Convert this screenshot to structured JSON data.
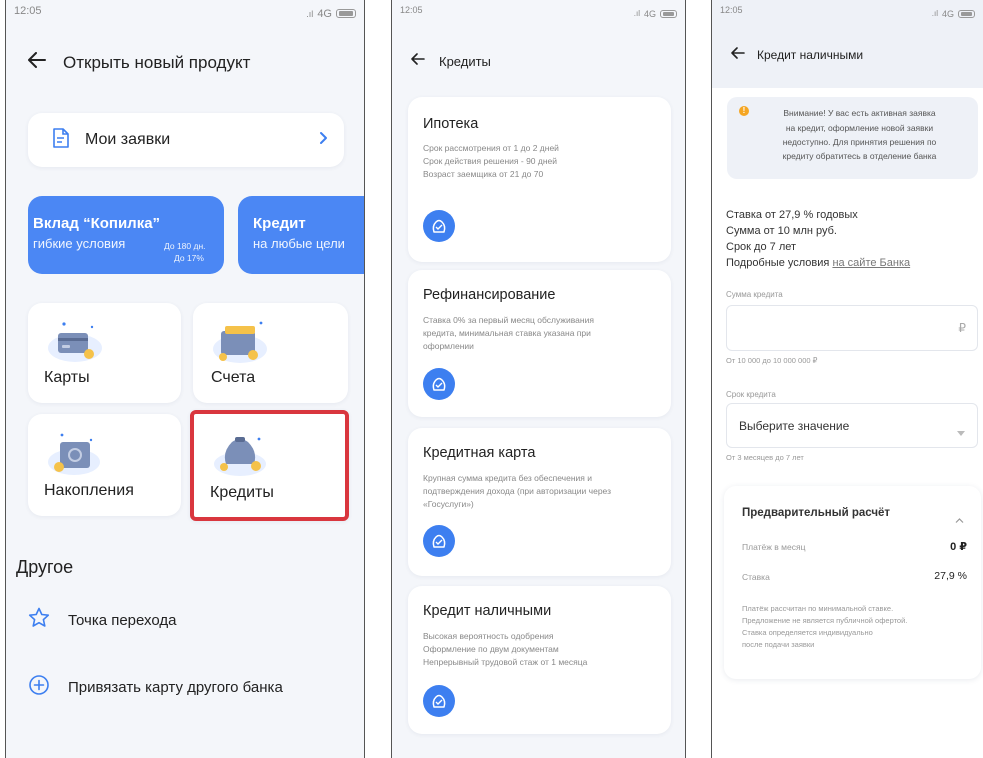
{
  "status": {
    "time": "12:05",
    "network": "4G"
  },
  "screen1": {
    "title": "Открыть новый продукт",
    "my_requests": "Мои заявки",
    "promo1": {
      "title": "Вклад “Копилка”",
      "subtitle": "гибкие условия",
      "term": "До 180 дн.",
      "rate": "До 17%"
    },
    "promo2": {
      "title": "Кредит",
      "subtitle": "на любые цели"
    },
    "tiles": {
      "cards": "Карты",
      "accounts": "Счета",
      "savings": "Накопления",
      "credits": "Кредиты"
    },
    "other_header": "Другое",
    "other_items": [
      "Точка перехода",
      "Привязать карту другого банка"
    ]
  },
  "screen2": {
    "title": "Кредиты",
    "products": [
      {
        "title": "Ипотека",
        "lines": [
          "Срок рассмотрения от 1 до 2 дней",
          "Срок действия решения - 90 дней",
          "Возраст заемщика от 21 до 70"
        ]
      },
      {
        "title": "Рефинансирование",
        "lines": [
          "Ставка 0% за первый месяц обслуживания",
          "кредита, минимальная ставка указана при",
          "оформлении"
        ]
      },
      {
        "title": "Кредитная карта",
        "lines": [
          "Крупная сумма кредита без обеспечения и",
          "подтверждения дохода (при авторизации через",
          "«Госуслуги»)"
        ]
      },
      {
        "title": "Кредит наличными",
        "lines": [
          "Высокая вероятность одобрения",
          "Оформление по двум документам",
          "Непрерывный трудовой стаж от 1 месяца"
        ]
      }
    ]
  },
  "screen3": {
    "title": "Кредит наличными",
    "warning_lines": [
      "Внимание! У вас есть активная заявка",
      "на кредит, оформление новой заявки",
      "недоступно. Для принятия решения по",
      "кредиту обратитесь в отделение банка"
    ],
    "info_lines": [
      "Ставка от 27,9 % годовых",
      "Сумма от 10 млн руб.",
      "Срок до 7 лет"
    ],
    "details_prefix": "Подробные условия ",
    "details_link": "на сайте Банка",
    "amount_label": "Сумма кредита",
    "currency": "₽",
    "amount_hint": "От 10 000 до 10 000 000 ₽",
    "term_label": "Срок кредита",
    "term_placeholder": "Выберите значение",
    "term_hint": "От 3 месяцев до 7 лет",
    "calc_title": "Предварительный расчёт",
    "payment_label": "Платёж в месяц",
    "payment_value": "0 ₽",
    "rate_label": "Ставка",
    "rate_value": "27,9 %",
    "disclaimer": [
      "Платёж рассчитан по минимальной ставке.",
      "Предложение не является публичной офертой.",
      "Ставка определяется индивидуально",
      "после подачи заявки"
    ]
  },
  "colors": {
    "accent": "#3d7ff0",
    "highlight": "#d9363e",
    "warning": "#f5a623"
  }
}
